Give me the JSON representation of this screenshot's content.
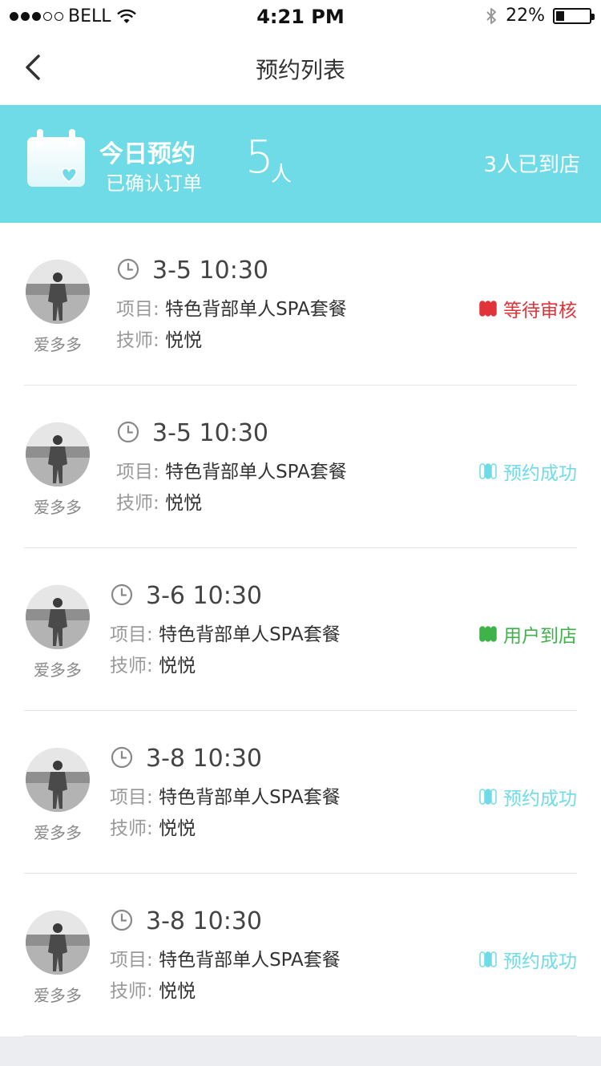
{
  "status_bar": {
    "carrier": "BELL",
    "time": "4:21 PM",
    "battery": "22%",
    "battery_level": 0.22
  },
  "nav": {
    "title": "预约列表",
    "back_icon": "chevron-left-icon"
  },
  "banner": {
    "title": "今日预约",
    "subtitle": "已确认订单",
    "count": "5",
    "unit": "人",
    "arrived": "3人已到店",
    "icon": "calendar-heart-icon"
  },
  "labels": {
    "project": "项目:",
    "therapist": "技师:"
  },
  "colors": {
    "accent": "#6fdbe6",
    "pending": "#e0343a",
    "success": "#6fdbe6",
    "arrived": "#3fb24a"
  },
  "appointments": [
    {
      "user": "爱多多",
      "time": "3-5 10:30",
      "project": "特色背部单人SPA套餐",
      "therapist": "悦悦",
      "status": "等待审核",
      "status_type": "pending"
    },
    {
      "user": "爱多多",
      "time": "3-5 10:30",
      "project": "特色背部单人SPA套餐",
      "therapist": "悦悦",
      "status": "预约成功",
      "status_type": "success"
    },
    {
      "user": "爱多多",
      "time": "3-6 10:30",
      "project": "特色背部单人SPA套餐",
      "therapist": "悦悦",
      "status": "用户到店",
      "status_type": "arrived"
    },
    {
      "user": "爱多多",
      "time": "3-8 10:30",
      "project": "特色背部单人SPA套餐",
      "therapist": "悦悦",
      "status": "预约成功",
      "status_type": "success"
    },
    {
      "user": "爱多多",
      "time": "3-8 10:30",
      "project": "特色背部单人SPA套餐",
      "therapist": "悦悦",
      "status": "预约成功",
      "status_type": "success"
    }
  ]
}
